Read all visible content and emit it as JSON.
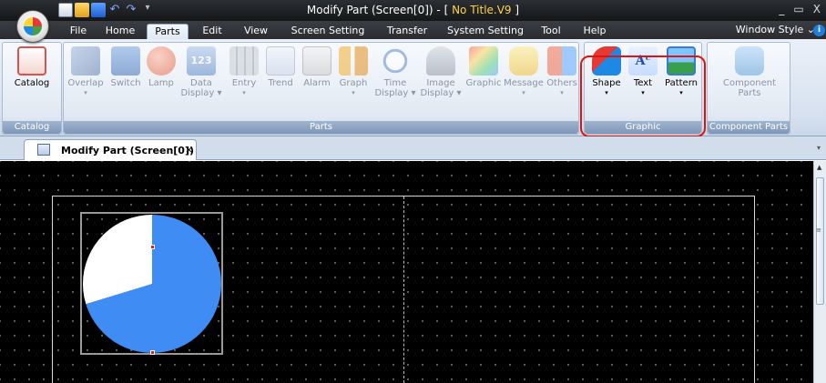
{
  "window": {
    "title_main": "Modify Part (Screen[0]) - [ ",
    "title_accent": "No Title.V9",
    "title_end": " ]",
    "controls": [
      "_",
      "▭",
      "X"
    ]
  },
  "quick_access": {
    "menu_glyph": "▾"
  },
  "menu": {
    "tabs": [
      "File",
      "Home",
      "Parts",
      "Edit",
      "View",
      "Screen Setting",
      "Transfer",
      "System Setting",
      "Tool",
      "Help"
    ],
    "active_tab": "Parts",
    "window_style_label": "Window Style",
    "window_style_caret": "⌄",
    "help_icon_glyph": "i"
  },
  "ribbon": {
    "groups": {
      "catalog": "Catalog",
      "parts": "Parts",
      "graphic": "Graphic",
      "component_parts": "Component Parts"
    },
    "buttons": {
      "catalog": "Catalog",
      "overlap": "Overlap",
      "switch": "Switch",
      "lamp": "Lamp",
      "data_display_1": "Data",
      "data_display_2": "Display",
      "data_icon_text": "123",
      "entry": "Entry",
      "trend": "Trend",
      "alarm": "Alarm",
      "graph": "Graph",
      "time_display_1": "Time",
      "time_display_2": "Display",
      "image_display_1": "Image",
      "image_display_2": "Display",
      "graphic": "Graphic",
      "message": "Message",
      "others": "Others",
      "shape": "Shape",
      "text": "Text",
      "text_icon_glyph": "Aᶜ",
      "pattern": "Pattern",
      "component_parts_1": "Component",
      "component_parts_2": "Parts",
      "dropdown_arrow": "▾"
    }
  },
  "document": {
    "tab_label": "Modify Part (Screen[0])",
    "tab_close": "×",
    "dropdown": "▾"
  },
  "canvas": {
    "part": {
      "type": "pie",
      "white_fraction": 0.297,
      "colors": {
        "fill": "#3f8cf5",
        "empty": "#ffffff",
        "background": "#000000"
      }
    }
  },
  "scrollbar": {
    "up": "▲",
    "grip": "≡"
  },
  "colors": {
    "highlight": "#e0140f",
    "title_accent": "#ffd34e"
  }
}
